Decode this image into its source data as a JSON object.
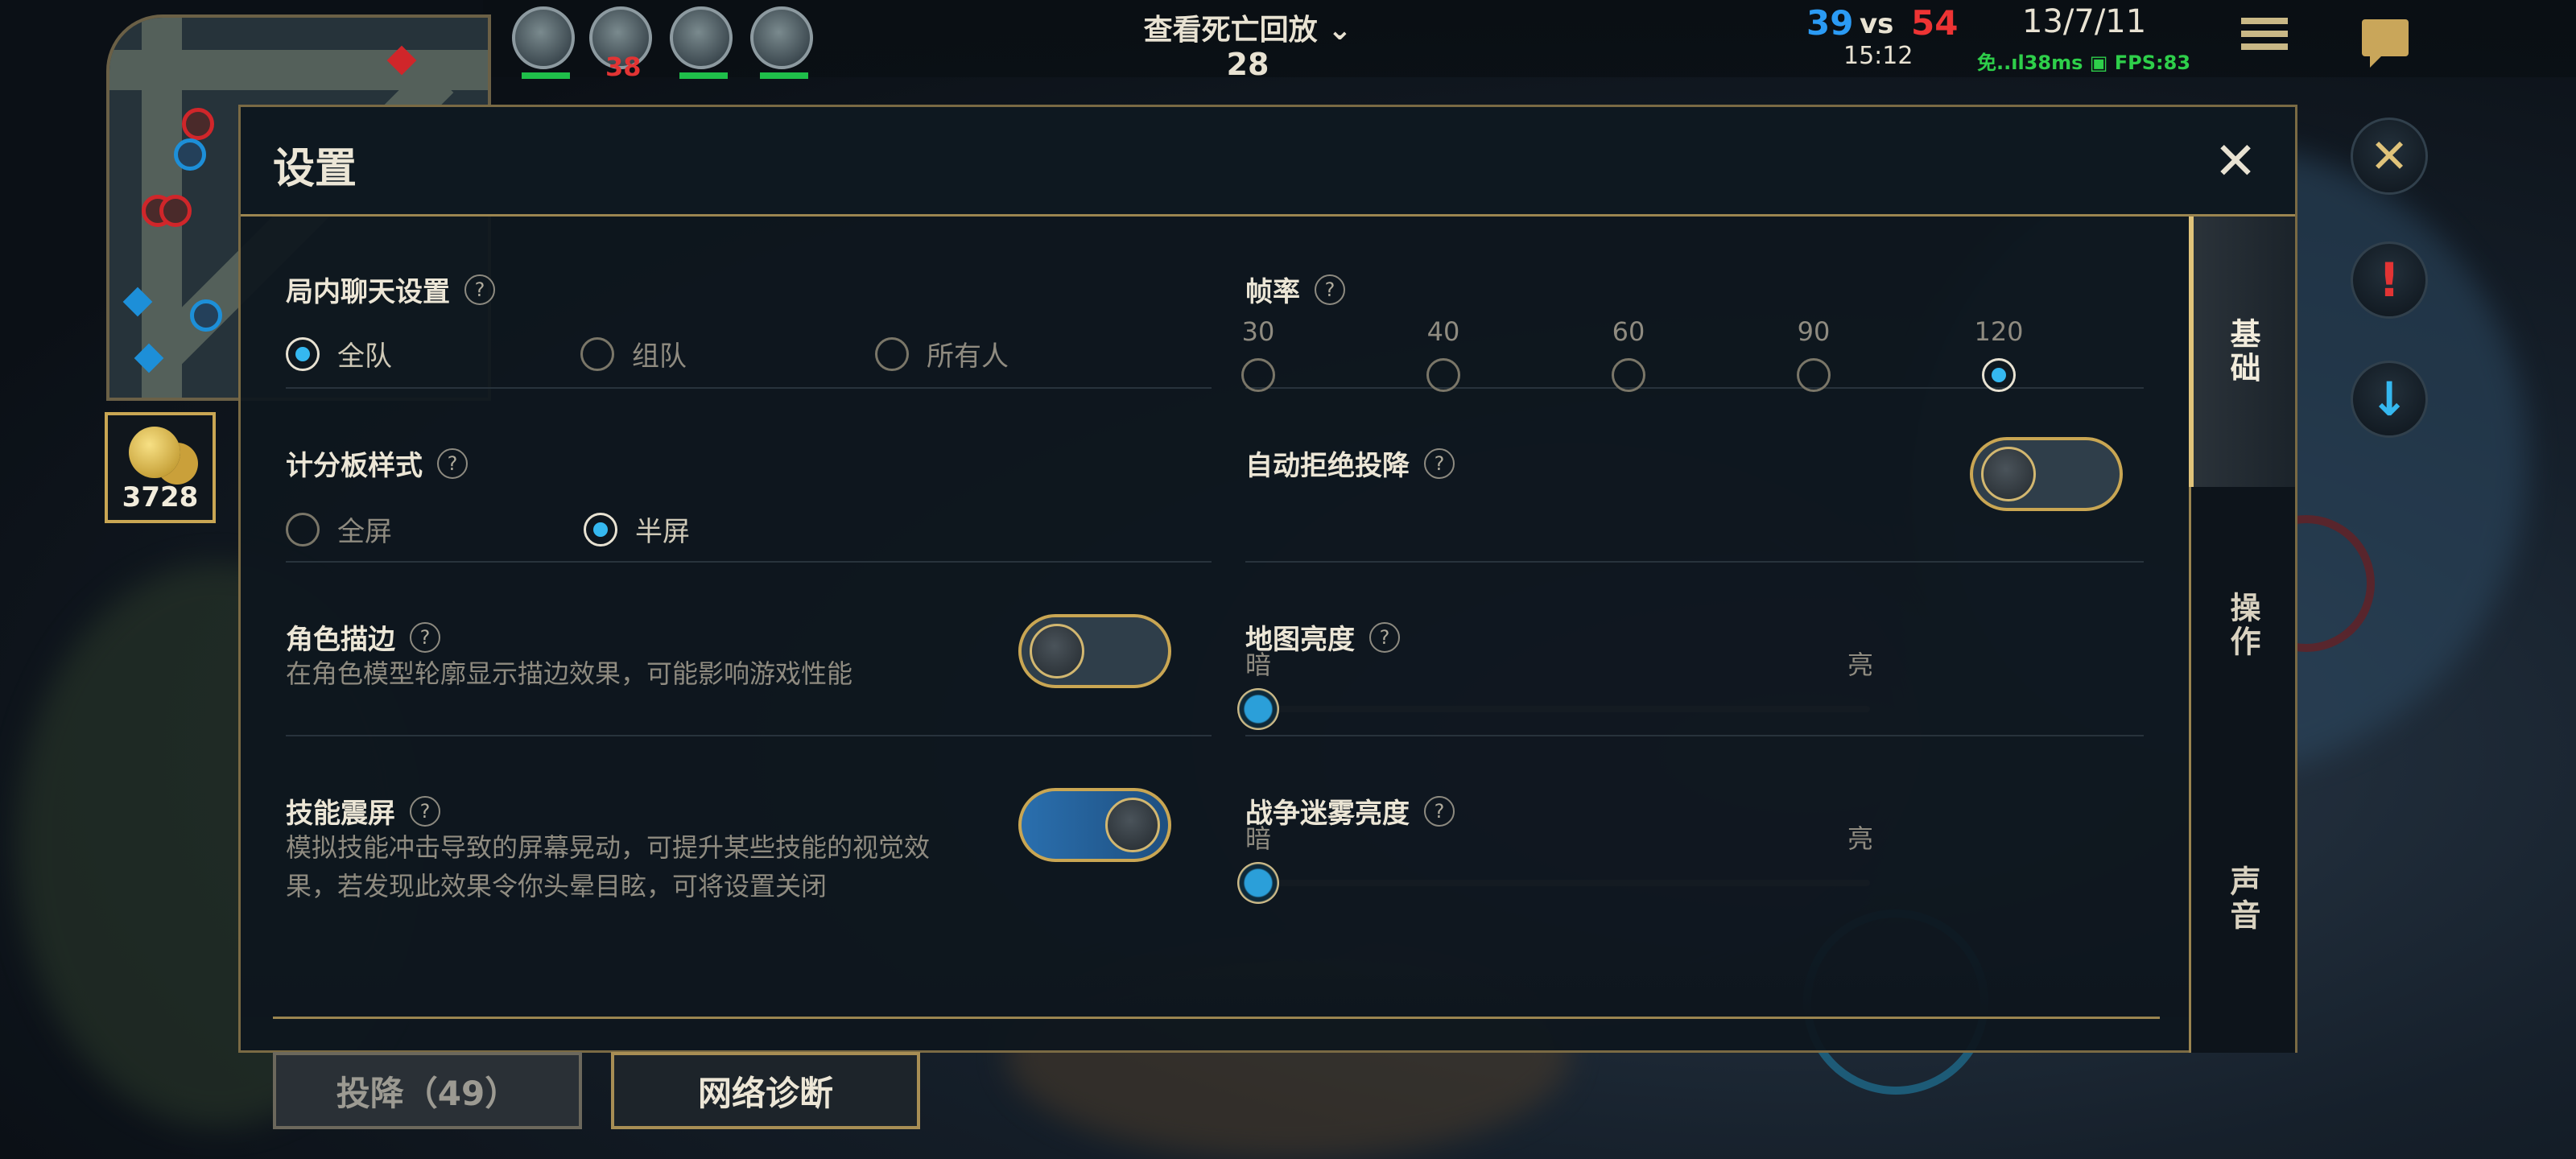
{
  "minimap": {
    "gold": "3728",
    "dead_timer": "38"
  },
  "top": {
    "replay_label": "查看死亡回放",
    "replay_count": "28",
    "score_blue": "39",
    "score_vs": "vs",
    "score_red": "54",
    "game_time": "15:12",
    "kda": "13/7/11",
    "network": "免..ıl38ms ▣ FPS:83"
  },
  "dialog": {
    "title": "设置",
    "tabs": [
      "基础",
      "操作",
      "声音"
    ],
    "active_tab": "基础",
    "chat": {
      "title": "局内聊天设置",
      "options": [
        "全队",
        "组队",
        "所有人"
      ],
      "selected": "全队"
    },
    "fps": {
      "title": "帧率",
      "options": [
        "30",
        "40",
        "60",
        "90",
        "120"
      ],
      "selected": "120"
    },
    "scoreboard": {
      "title": "计分板样式",
      "options": [
        "全屏",
        "半屏"
      ],
      "selected": "半屏"
    },
    "auto_reject": {
      "title": "自动拒绝投降",
      "enabled": false
    },
    "outline": {
      "title": "角色描边",
      "desc": "在角色模型轮廓显示描边效果，可能影响游戏性能",
      "enabled": false
    },
    "map_brightness": {
      "title": "地图亮度",
      "low": "暗",
      "high": "亮",
      "value": 0
    },
    "shake": {
      "title": "技能震屏",
      "desc": "模拟技能冲击导致的屏幕晃动，可提升某些技能的视觉效果，若发现此效果令你头晕目眩，可将设置关闭",
      "enabled": true
    },
    "fog_brightness": {
      "title": "战争迷雾亮度",
      "low": "暗",
      "high": "亮",
      "value": 0
    },
    "help_glyph": "?",
    "close_glyph": "✕"
  },
  "footer": {
    "surrender_label": "投降（49）",
    "network_label": "网络诊断"
  },
  "colors": {
    "accent_gold": "#c9a653",
    "accent_blue": "#35b8f0",
    "team_blue": "#2b9bf4",
    "team_red": "#ee3434"
  }
}
